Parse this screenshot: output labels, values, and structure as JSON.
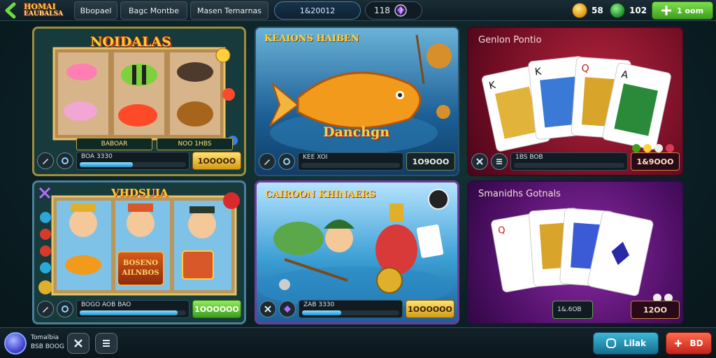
{
  "header": {
    "logo_line1": "HOMAI",
    "logo_line2": "EAUBALSA",
    "tabs": [
      "Bbopael",
      "Bagc Montbe",
      "Masen Temarnas"
    ],
    "balance": "1&20012",
    "level": "118",
    "coins": "58",
    "clovers": "102",
    "buy_label": "1 oom"
  },
  "cards": [
    {
      "title": "NOIDALAS",
      "sublabels": [
        "BABOAR",
        "NOO 1HBS"
      ],
      "info_text": "BOA 3330",
      "progress": 0.5,
      "button": "1OOOOO",
      "button_style": "gold"
    },
    {
      "title": "KEAIONS HAIBEN",
      "art_word": "Danchgn",
      "info_text": "KEE    XOI",
      "progress": 0.0,
      "button": "1O9OOO",
      "button_style": "dark"
    },
    {
      "title": "Genlon Pontio",
      "info_text": "1BS       BOB",
      "progress": 0.0,
      "button": "1&9OOO",
      "button_style": "darkr"
    },
    {
      "title": "VHDSUIA",
      "badge_word": "BOSENO AILNBOS",
      "info_text": "BOGO  AOB   BAO",
      "progress": 0.92,
      "button": "1OOOOOO",
      "button_style": "green"
    },
    {
      "title": "CAIROON KHINAERS",
      "info_text": "ZAB 3330",
      "progress": 0.4,
      "button": "1OOOOOO",
      "button_style": "gold"
    },
    {
      "title": "Smanidhs Gotnals",
      "info_text": "1&.6OB",
      "progress": 0.0,
      "button": "12OO",
      "button_style": "darkr"
    }
  ],
  "footer": {
    "user_line1": "Tomalbia",
    "user_line2": "BSB BOOG",
    "link_label": "Lilak",
    "red_label": "BD"
  },
  "colors": {
    "accent_gold": "#ffcb2f",
    "accent_green": "#3c9e1f",
    "accent_blue": "#1f8fd0",
    "accent_red": "#c4231c"
  },
  "icons": [
    "back-icon",
    "gem-icon",
    "coin-icon",
    "clover-icon",
    "plus-icon",
    "pen-icon",
    "gear-icon",
    "tools-icon",
    "menu-icon",
    "chat-icon"
  ]
}
